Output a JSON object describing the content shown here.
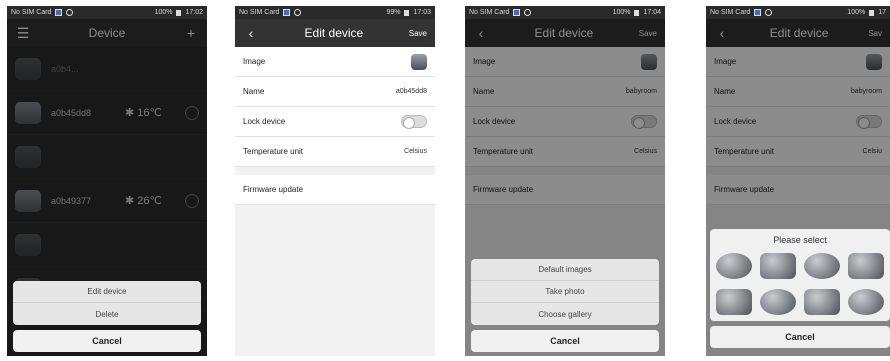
{
  "screen1": {
    "status": {
      "carrier": "No SIM Card",
      "battery": "100%",
      "time": "17:02"
    },
    "nav": {
      "title": "Device"
    },
    "devices": [
      {
        "name": "a0b4...",
        "temp": "",
        "dim": true
      },
      {
        "name": "a0b45dd8",
        "temp": "16℃",
        "dim": false
      },
      {
        "name": "",
        "temp": "",
        "dim": true
      },
      {
        "name": "a0b49377",
        "temp": "26℃",
        "dim": false
      },
      {
        "name": "",
        "temp": "",
        "dim": true
      },
      {
        "name": "",
        "temp": "",
        "dim": true
      }
    ],
    "sheet": {
      "edit": "Edit device",
      "delete": "Delete",
      "cancel": "Cancel"
    }
  },
  "screen2": {
    "status": {
      "carrier": "No SIM Card",
      "battery": "99%",
      "time": "17:03"
    },
    "nav": {
      "title": "Edit device",
      "save": "Save"
    },
    "rows": {
      "image": "Image",
      "name_label": "Name",
      "name_value": "a0b45dd8",
      "lock": "Lock device",
      "temp_label": "Temperature unit",
      "temp_value": "Celsius",
      "firmware": "Firmware update"
    }
  },
  "screen3": {
    "status": {
      "carrier": "No SIM Card",
      "battery": "100%",
      "time": "17:04"
    },
    "nav": {
      "title": "Edit device",
      "save": "Save"
    },
    "rows": {
      "image": "Image",
      "name_label": "Name",
      "name_value": "babyroom",
      "lock": "Lock device",
      "temp_label": "Temperature unit",
      "temp_value": "Celsius",
      "firmware": "Firmware update"
    },
    "sheet": {
      "default": "Default images",
      "take": "Take photo",
      "gallery": "Choose gallery",
      "cancel": "Cancel"
    }
  },
  "screen4": {
    "status": {
      "carrier": "No SIM Card",
      "battery": "100%",
      "time": "17"
    },
    "nav": {
      "title": "Edit device",
      "save": "Sav"
    },
    "rows": {
      "image": "Image",
      "name_label": "Name",
      "name_value": "babyroom",
      "lock": "Lock device",
      "temp_label": "Temperature unit",
      "temp_value": "Celsiu",
      "firmware": "Firmware update"
    },
    "picker": {
      "title": "Please select",
      "cancel": "Cancel"
    }
  }
}
